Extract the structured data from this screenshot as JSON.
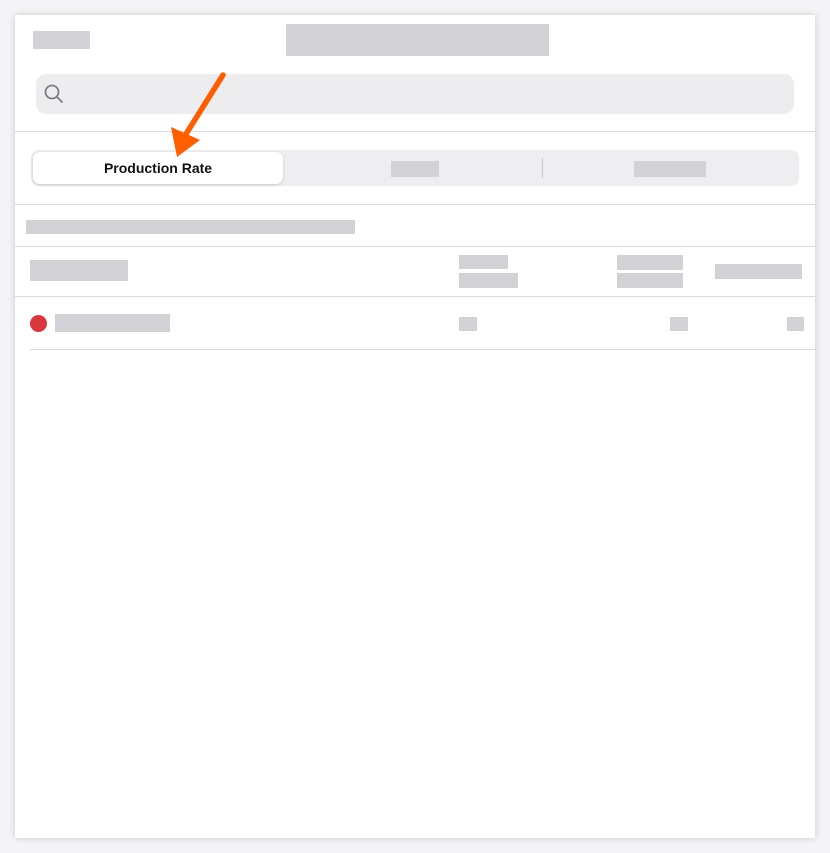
{
  "segmented_control": {
    "tabs": [
      {
        "label": "Production Rate",
        "selected": true
      },
      {
        "label": "",
        "selected": false
      },
      {
        "label": "",
        "selected": false
      }
    ]
  },
  "status": {
    "dot_color": "#d9363e"
  },
  "annotation": {
    "arrow_color": "#ff5e00"
  },
  "icons": {
    "search": "search-icon"
  }
}
